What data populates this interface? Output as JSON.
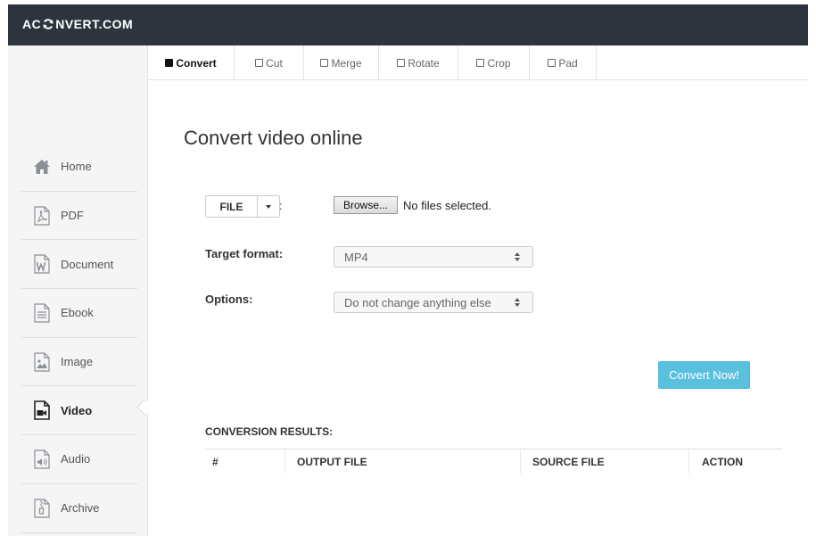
{
  "logo": {
    "prefix": "AC",
    "suffix": "NVERT.COM",
    "icon": "sync-icon"
  },
  "sidebar": {
    "items": [
      {
        "label": "Home",
        "icon": "home-icon"
      },
      {
        "label": "PDF",
        "icon": "pdf-file-icon"
      },
      {
        "label": "Document",
        "icon": "word-document-icon"
      },
      {
        "label": "Ebook",
        "icon": "ebook-icon"
      },
      {
        "label": "Image",
        "icon": "image-file-icon"
      },
      {
        "label": "Video",
        "icon": "video-file-icon",
        "active": true
      },
      {
        "label": "Audio",
        "icon": "audio-file-icon"
      },
      {
        "label": "Archive",
        "icon": "archive-file-icon"
      }
    ]
  },
  "tabs": [
    {
      "label": "Convert",
      "active": true
    },
    {
      "label": "Cut"
    },
    {
      "label": "Merge"
    },
    {
      "label": "Rotate"
    },
    {
      "label": "Crop"
    },
    {
      "label": "Pad"
    }
  ],
  "main": {
    "title": "Convert video online",
    "file_button": "FILE",
    "colon": ":",
    "browse_button": "Browse...",
    "no_file_text": "No files selected.",
    "target_format_label": "Target format:",
    "target_format_value": "MP4",
    "options_label": "Options:",
    "options_value": "Do not change anything else",
    "convert_button": "Convert Now!",
    "results_title": "CONVERSION RESULTS:",
    "results_columns": [
      "#",
      "OUTPUT FILE",
      "SOURCE FILE",
      "ACTION"
    ]
  },
  "colors": {
    "topbar": "#2d343e",
    "accent": "#5bc0de",
    "sidebar_bg": "#f5f5f5"
  }
}
